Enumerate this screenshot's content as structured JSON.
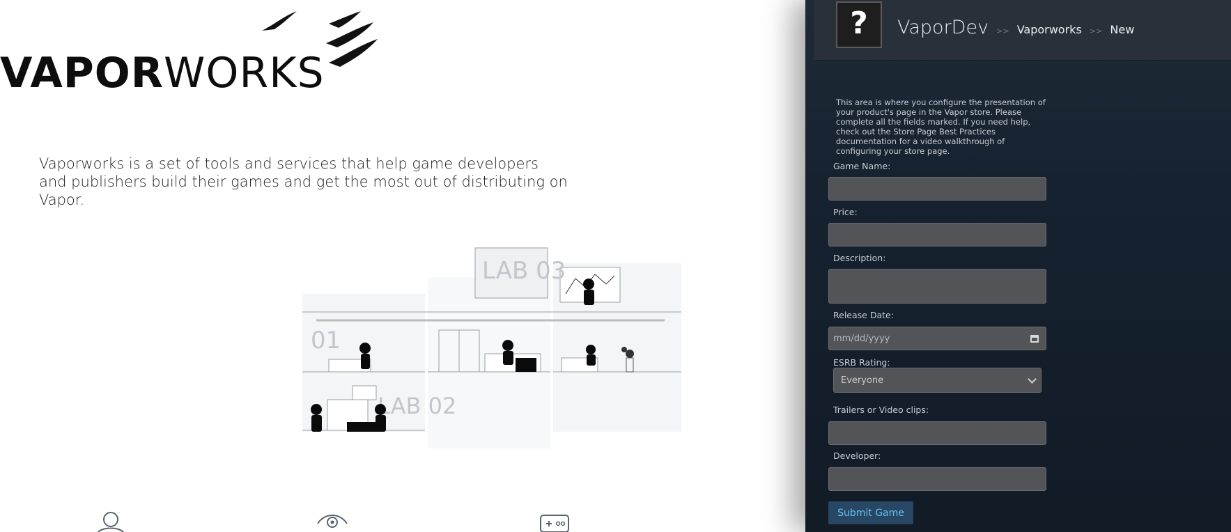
{
  "brand": {
    "logo_bold": "VAPOR",
    "logo_light": "WORKS",
    "tagline": "Vaporworks is a set of tools and services that help game developers and publishers build their games and get the most out of distributing on Vapor."
  },
  "illustration": {
    "lab_a": "01",
    "lab_b": "LAB 02",
    "lab_c": "LAB 03"
  },
  "features": [
    {
      "icon": "user-icon"
    },
    {
      "icon": "eye-icon"
    },
    {
      "icon": "gamepad-icon"
    }
  ],
  "panel": {
    "avatar_glyph": "?",
    "breadcrumb": {
      "root": "VaporDev",
      "sep": ">>",
      "items": [
        "Vaporworks",
        "New"
      ]
    },
    "help_text": "This area is where you configure the presentation of your product's page in the Vapor store. Please complete all the fields marked. If you need help, check out the Store Page Best Practices documentation for a video walkthrough of configuring your store page.",
    "fields": {
      "game_name": {
        "label": "Game Name:",
        "value": ""
      },
      "price": {
        "label": "Price:",
        "value": ""
      },
      "description": {
        "label": "Description:",
        "value": ""
      },
      "release_date": {
        "label": "Release Date:",
        "placeholder": "mm/dd/yyyy"
      },
      "esrb": {
        "label": "ESRB Rating:",
        "selected": "Everyone"
      },
      "trailers": {
        "label": "Trailers or Video clips:",
        "value": ""
      },
      "developer": {
        "label": "Developer:",
        "value": ""
      }
    },
    "submit_label": "Submit Game"
  },
  "colors": {
    "panel_bg": "#162230",
    "header_bg": "#2a3039",
    "input_bg": "#535458",
    "button_bg": "#274764",
    "button_text": "#67c1f5"
  }
}
